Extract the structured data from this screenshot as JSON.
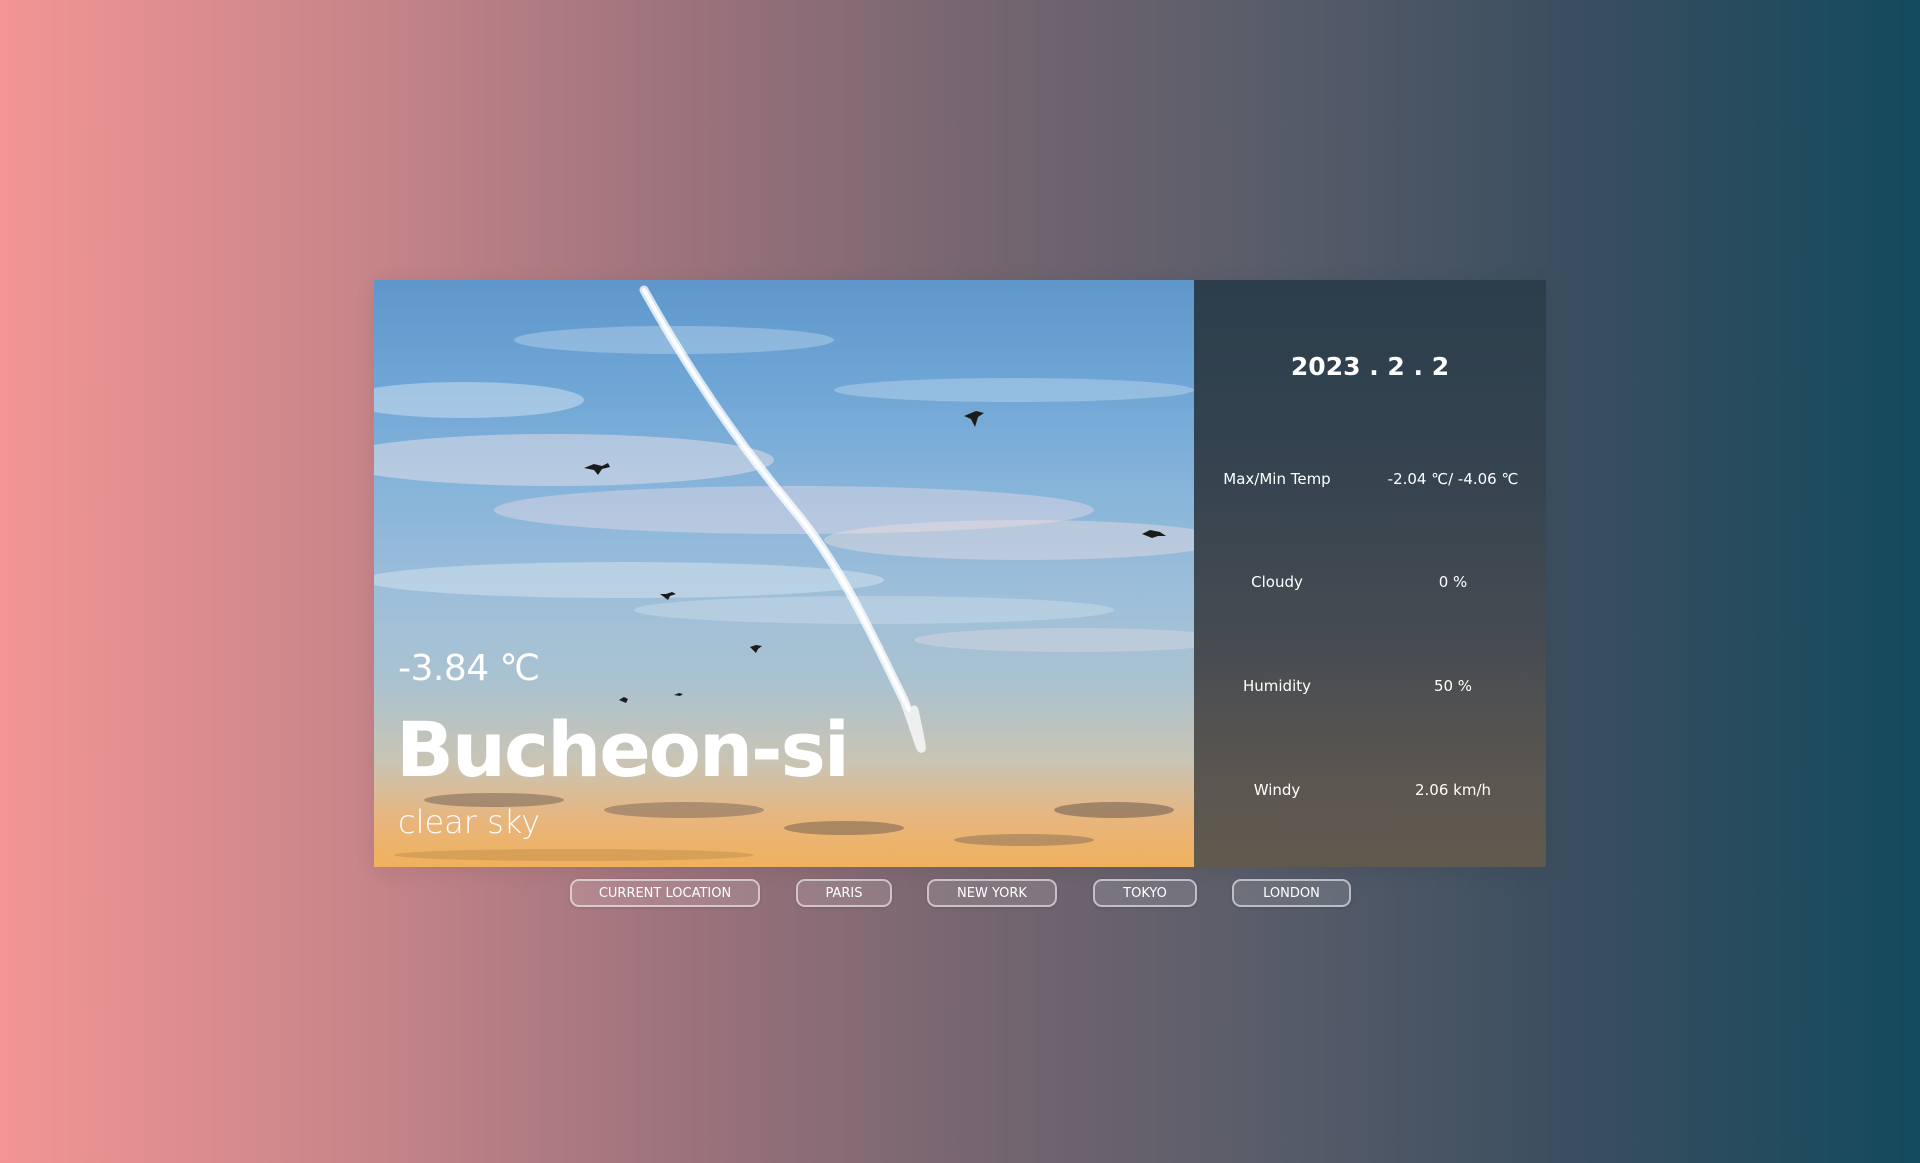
{
  "weather": {
    "temperature": "-3.84 ℃",
    "city": "Bucheon-si",
    "description": "clear sky"
  },
  "details": {
    "date": "2023 . 2 . 2",
    "rows": [
      {
        "label": "Max/Min Temp",
        "value": "-2.04 ℃/ -4.06 ℃"
      },
      {
        "label": "Cloudy",
        "value": "0 %"
      },
      {
        "label": "Humidity",
        "value": "50 %"
      },
      {
        "label": "Windy",
        "value": "2.06 km/h"
      }
    ]
  },
  "city_buttons": [
    {
      "label": "CURRENT LOCATION"
    },
    {
      "label": "PARIS"
    },
    {
      "label": "NEW YORK"
    },
    {
      "label": "TOKYO"
    },
    {
      "label": "LONDON"
    }
  ],
  "colors": {
    "page_gradient_left": "#f39594",
    "page_gradient_right": "#134a5d",
    "panel": "#34434f"
  }
}
